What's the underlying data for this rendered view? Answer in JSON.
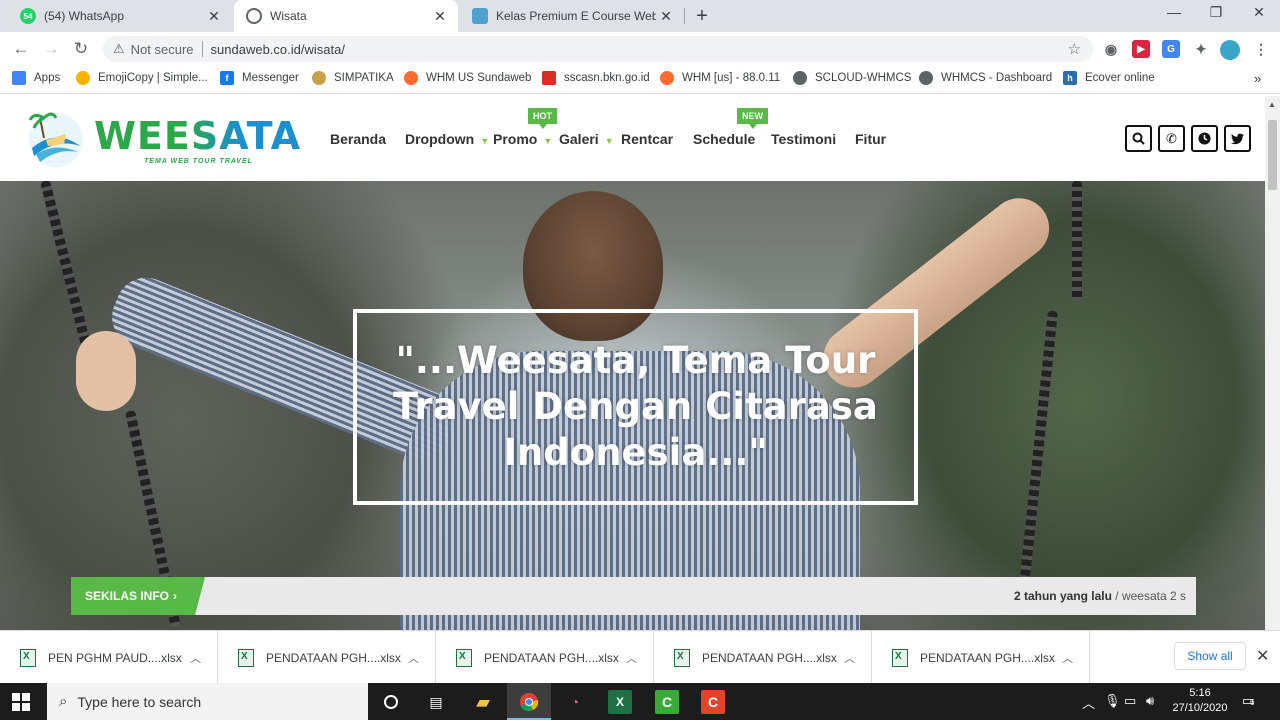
{
  "browser": {
    "tabs": [
      {
        "title": "(54) WhatsApp",
        "icon": "whatsapp-icon",
        "color": "#25d366"
      },
      {
        "title": "Wisata",
        "icon": "globe-icon",
        "color": "#5f6368"
      },
      {
        "title": "Kelas Premium E Course Website",
        "icon": "course-icon",
        "color": "#4fa3d1"
      }
    ],
    "address": {
      "security": "Not secure",
      "url": "sundaweb.co.id/wisata/"
    },
    "bookmarks": [
      {
        "label": "Apps",
        "icon": "apps-grid-icon",
        "color": "#4285f4"
      },
      {
        "label": "EmojiCopy | Simple...",
        "icon": "emoji-icon",
        "color": "#f4b400"
      },
      {
        "label": "Messenger",
        "icon": "facebook-icon",
        "color": "#1877f2"
      },
      {
        "label": "SIMPATIKA",
        "icon": "simpatika-icon",
        "color": "#c8a24a"
      },
      {
        "label": "WHM US Sundaweb",
        "icon": "cpanel-icon",
        "color": "#ff6c2c"
      },
      {
        "label": "sscasn.bkn.go.id",
        "icon": "bkn-icon",
        "color": "#d93025"
      },
      {
        "label": "WHM [us] - 88.0.11",
        "icon": "cpanel-icon",
        "color": "#ff6c2c"
      },
      {
        "label": "SCLOUD-WHMCS",
        "icon": "globe-icon",
        "color": "#5f6368"
      },
      {
        "label": "WHMCS - Dashboard",
        "icon": "globe-icon",
        "color": "#5f6368"
      },
      {
        "label": "Ecover online",
        "icon": "ecover-icon",
        "color": "#2a6db0"
      }
    ]
  },
  "site": {
    "logo": {
      "text": "WEESATA",
      "tagline": "TEMA WEB TOUR TRAVEL"
    },
    "menu": [
      {
        "label": "Beranda",
        "caret": false
      },
      {
        "label": "Dropdown",
        "caret": true
      },
      {
        "label": "Promo",
        "caret": true,
        "badge": "HOT"
      },
      {
        "label": "Galeri",
        "caret": true
      },
      {
        "label": "Rentcar",
        "caret": false
      },
      {
        "label": "Schedule",
        "caret": false,
        "badge": "NEW"
      },
      {
        "label": "Testimoni",
        "caret": false
      },
      {
        "label": "Fitur",
        "caret": false
      }
    ],
    "hero": {
      "quote": "\"...Weesata, Tema Tour Travel Dengan Citarasa Indonesia...\""
    },
    "ticker": {
      "label": "SEKILAS INFO",
      "time": "2 tahun yang lalu",
      "text": " / weesata 2 s"
    },
    "accent": "#58b947"
  },
  "downloads": {
    "items": [
      "PEN PGHM PAUD....xlsx",
      "PENDATAAN PGH....xlsx",
      "PENDATAAN PGH....xlsx",
      "PENDATAAN PGH....xlsx",
      "PENDATAAN PGH....xlsx"
    ],
    "show_all": "Show all"
  },
  "taskbar": {
    "search_placeholder": "Type here to search",
    "time": "5:16",
    "date": "27/10/2020",
    "notifications": "6"
  }
}
